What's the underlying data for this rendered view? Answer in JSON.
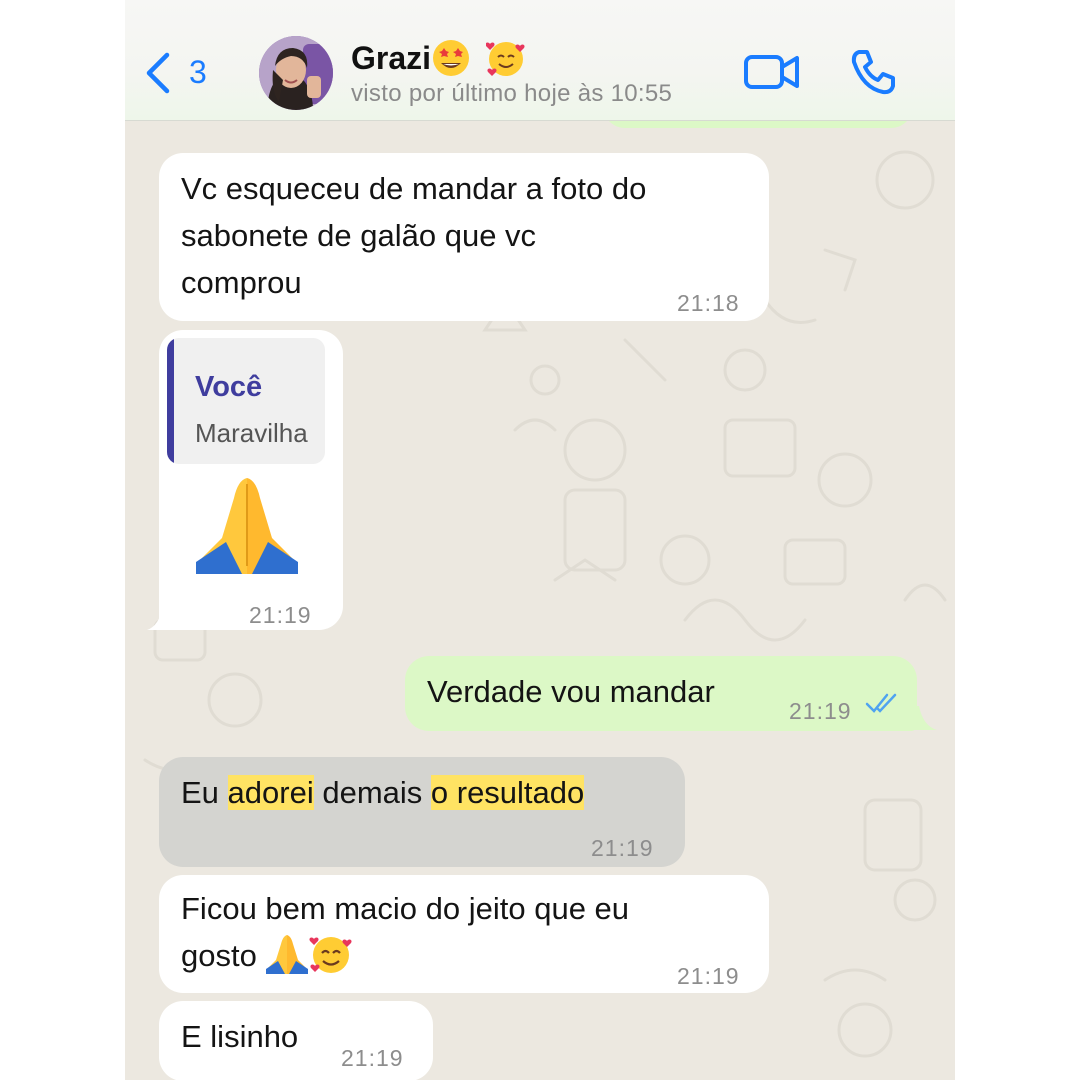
{
  "header": {
    "back_count": "3",
    "contact_name": "Grazi",
    "last_seen": "visto por último hoje às 10:55",
    "name_emojis": [
      "star-struck-emoji",
      "smiling-face-with-hearts-emoji"
    ]
  },
  "messages": [
    {
      "lines": [
        "Vc esqueceu de mandar a foto do",
        "sabonete de galão que vc",
        "comprou"
      ],
      "time": "21:18"
    },
    {
      "quote_author": "Você",
      "quote_text": "Maravilha",
      "emoji": "folded-hands-emoji",
      "time": "21:19"
    },
    {
      "text": "Verdade vou mandar",
      "time": "21:19",
      "status": "read"
    },
    {
      "parts": [
        "Eu ",
        "adorei",
        " demais ",
        "o resultado"
      ],
      "time": "21:19"
    },
    {
      "lines": [
        "Ficou bem macio do jeito que eu",
        "gosto"
      ],
      "emojis": [
        "folded-hands-emoji",
        "smiling-face-with-hearts-emoji"
      ],
      "time": "21:19"
    },
    {
      "text": "E lisinho",
      "time": "21:19"
    }
  ],
  "colors": {
    "accent": "#1a7cff",
    "incoming_bubble": "#ffffff",
    "outgoing_bubble": "#dcf8c6",
    "selected_bubble": "#d4d4d0",
    "highlight": "#ffe363",
    "quote_author": "#3f3d9e",
    "read_ticks": "#4fa3f0",
    "chat_background": "#ece8e0"
  }
}
